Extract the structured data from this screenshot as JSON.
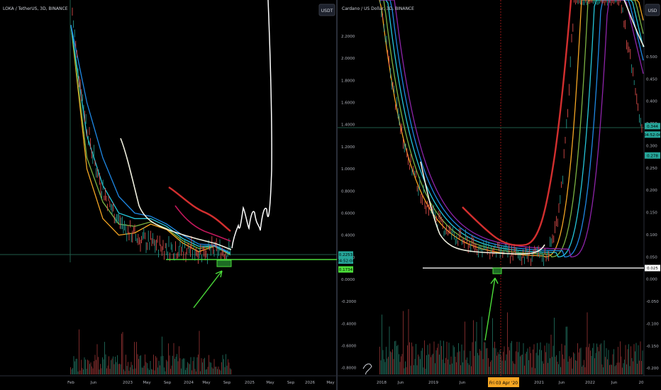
{
  "chart_data": [
    {
      "type": "line",
      "title": "LOKA / TetherUS, 3D, BINANCE",
      "currency_button": "USDT",
      "y_ticks": [
        "2.2000",
        "2.0000",
        "1.8000",
        "1.6000",
        "1.4000",
        "1.2000",
        "1.0000",
        "0.8000",
        "0.6000",
        "0.4000",
        "0.2000",
        "0.0000",
        "-0.2000",
        "-0.4000",
        "-0.6000",
        "-0.8000"
      ],
      "x_ticks": [
        "Feb",
        "Jun",
        "2023",
        "May",
        "Sep",
        "2024",
        "May",
        "Sep",
        "2025",
        "May",
        "Sep",
        "2026",
        "May"
      ],
      "price_labels": [
        {
          "text": "0.2253",
          "color": "#26a69a",
          "value": 0.2253
        },
        {
          "text": "04:52:04",
          "color": "#26a69a",
          "value": 0.17
        },
        {
          "text": "0.1734",
          "color": "#4cde3a",
          "value": 0.09
        }
      ],
      "support_line_value": 0.173,
      "accent_colors": {
        "support": "#4cde3a",
        "arrow": "#4cde3a",
        "projection": "#ffffff"
      },
      "series": [
        {
          "values": [
            2.3,
            1.0,
            0.55,
            0.4,
            0.42,
            0.5,
            0.45,
            0.33,
            0.25,
            0.3,
            0.22
          ]
        },
        {
          "values": [
            2.3,
            1.1,
            0.7,
            0.5,
            0.48,
            0.52,
            0.46,
            0.35,
            0.28,
            0.3,
            0.22
          ]
        },
        {
          "values": [
            2.3,
            1.3,
            0.85,
            0.6,
            0.55,
            0.55,
            0.48,
            0.37,
            0.3,
            0.3,
            0.23
          ]
        },
        {
          "values": [
            2.3,
            1.6,
            1.1,
            0.75,
            0.6,
            0.57,
            0.5,
            0.4,
            0.32,
            0.31,
            0.24
          ]
        }
      ]
    },
    {
      "type": "line",
      "title": "Cardano / US Dollar, 3D, BINANCE",
      "currency_button": "USD",
      "y_ticks": [
        "0.500",
        "0.450",
        "0.400",
        "0.350",
        "0.300",
        "0.250",
        "0.200",
        "0.150",
        "0.100",
        "0.050",
        "0.000",
        "-0.050",
        "-0.100",
        "-0.150",
        "-0.200"
      ],
      "x_ticks": [
        "2018",
        "Jun",
        "2019",
        "Jun",
        "2020",
        "Jun",
        "2021",
        "Jun",
        "2022",
        "Jun",
        "20"
      ],
      "date_label": "Fri 03 Apr '20",
      "price_labels": [
        {
          "text": "0.344",
          "color": "#26a69a",
          "value": 0.344
        },
        {
          "text": "04:52:04",
          "color": "#26a69a",
          "value": 0.325
        },
        {
          "text": "0.278",
          "color": "#26a69a",
          "value": 0.278
        },
        {
          "text": "0.025",
          "color": "#ffffff",
          "value": 0.025
        }
      ],
      "support_line_value": 0.025,
      "accent_colors": {
        "support": "#ffffff",
        "arrow": "#4cde3a"
      }
    }
  ]
}
